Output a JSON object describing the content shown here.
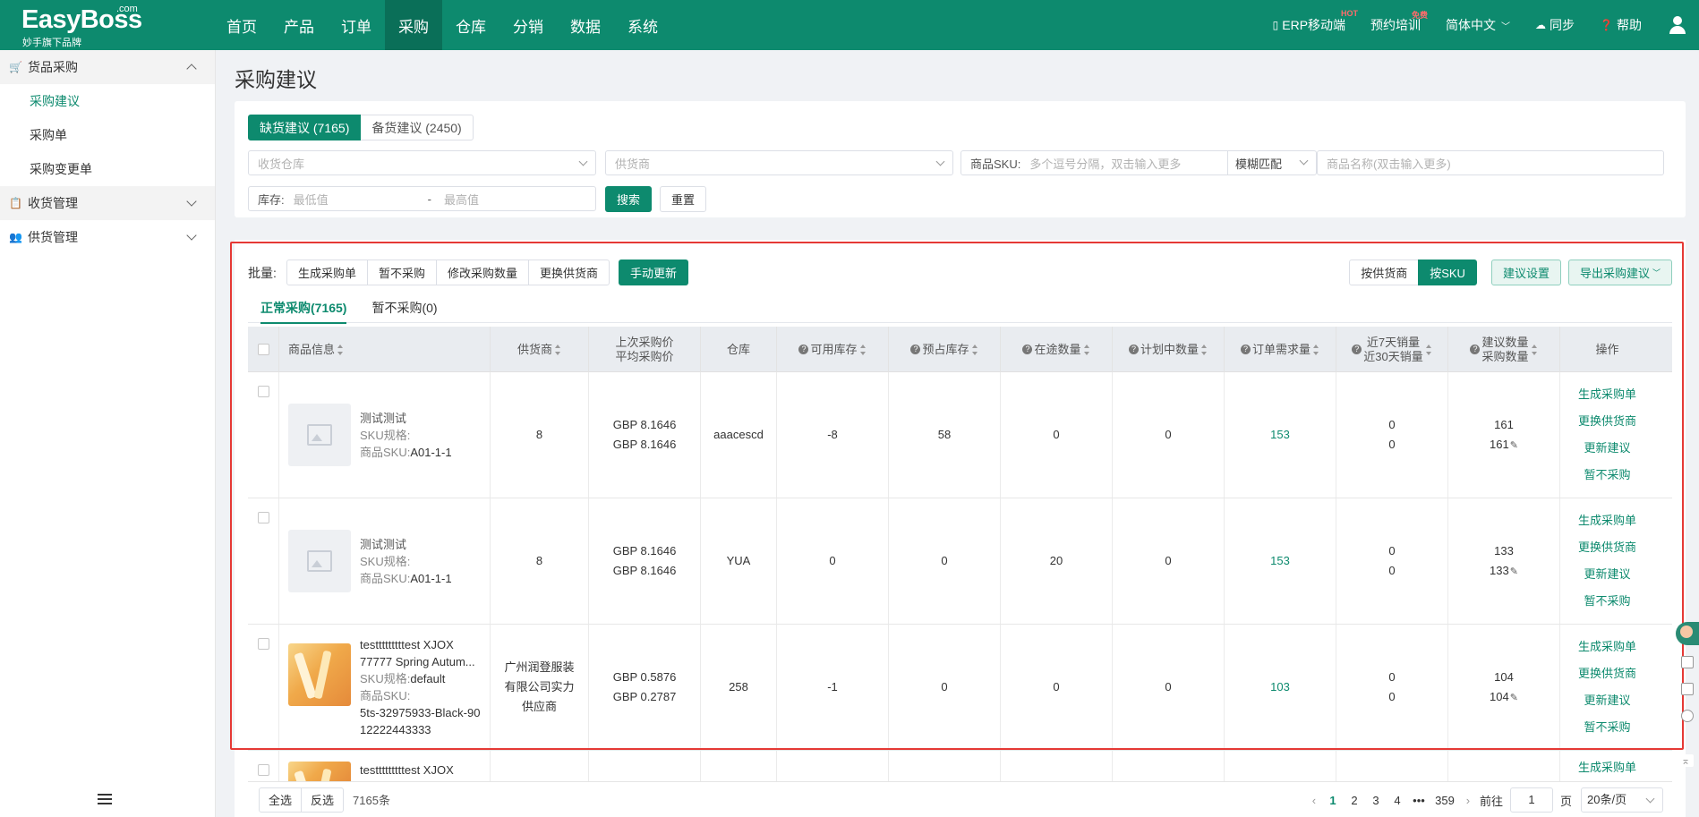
{
  "app": {
    "brand": "EasyBoss",
    "brand_com": ".com",
    "brand_sub": "妙手旗下品牌"
  },
  "topnav": {
    "menu": [
      "首页",
      "产品",
      "订单",
      "采购",
      "仓库",
      "分销",
      "数据",
      "系统"
    ],
    "active_index": 3,
    "erp": "ERP移动端",
    "erp_badge": "HOT",
    "training": "预约培训",
    "training_badge": "免费",
    "language": "简体中文",
    "sync": "同步",
    "help": "帮助"
  },
  "sidebar": {
    "groups": [
      {
        "label": "货品采购",
        "expanded": true,
        "items": [
          "采购建议",
          "采购单",
          "采购变更单"
        ],
        "active_item": 0
      },
      {
        "label": "收货管理",
        "expanded": false
      },
      {
        "label": "供货管理",
        "expanded": false
      }
    ]
  },
  "page": {
    "title": "采购建议"
  },
  "filters": {
    "tab_shortage": "缺货建议 (7165)",
    "tab_stock": "备货建议 (2450)",
    "warehouse_placeholder": "收货仓库",
    "supplier_placeholder": "供货商",
    "sku_label": "商品SKU:",
    "sku_placeholder": "多个逗号分隔，双击输入更多",
    "match_mode": "模糊匹配",
    "name_placeholder": "商品名称(双击输入更多)",
    "stock_label": "库存:",
    "min_placeholder": "最低值",
    "range_sep": "-",
    "max_placeholder": "最高值",
    "search": "搜索",
    "reset": "重置"
  },
  "toolbar": {
    "batch_label": "批量:",
    "batch_buttons": [
      "生成采购单",
      "暂不采购",
      "修改采购数量",
      "更换供货商"
    ],
    "manual_update": "手动更新",
    "by_supplier": "按供货商",
    "by_sku": "按SKU",
    "settings": "建议设置",
    "export": "导出采购建议"
  },
  "subtabs": {
    "normal": "正常采购(7165)",
    "paused": "暂不采购(0)"
  },
  "table": {
    "headers": {
      "product": "商品信息",
      "supplier": "供货商",
      "price_last": "上次采购价",
      "price_avg": "平均采购价",
      "warehouse": "仓库",
      "available": "可用库存",
      "reserved": "预占库存",
      "transit": "在途数量",
      "planned": "计划中数量",
      "demand": "订单需求量",
      "sales7": "近7天销量",
      "sales30": "近30天销量",
      "suggest": "建议数量",
      "purchase": "采购数量",
      "ops": "操作"
    },
    "sku_spec_label": "SKU规格:",
    "sku_code_label": "商品SKU:",
    "ops": [
      "生成采购单",
      "更换供货商",
      "更新建议",
      "暂不采购"
    ],
    "rows": [
      {
        "name": "测试测试",
        "spec": "",
        "sku": "A01-1-1",
        "supplier": "8",
        "price_last": "GBP 8.1646",
        "price_avg": "GBP 8.1646",
        "warehouse": "aaacescd",
        "available": "-8",
        "reserved": "58",
        "transit": "0",
        "planned": "0",
        "demand": "153",
        "sales7": "0",
        "sales30": "0",
        "suggest": "161",
        "purchase": "161"
      },
      {
        "name": "测试测试",
        "spec": "",
        "sku": "A01-1-1",
        "supplier": "8",
        "price_last": "GBP 8.1646",
        "price_avg": "GBP 8.1646",
        "warehouse": "YUA",
        "available": "0",
        "reserved": "0",
        "transit": "20",
        "planned": "0",
        "demand": "153",
        "sales7": "0",
        "sales30": "0",
        "suggest": "133",
        "purchase": "133"
      },
      {
        "name1": "testttttttttest XJOX",
        "name2": "77777 Spring Autum...",
        "spec": "default",
        "sku1": "5ts-32975933-Black-90",
        "sku2": "12222443333",
        "supplier1": "广州润登服装",
        "supplier2": "有限公司实力",
        "supplier3": "供应商",
        "price_last": "GBP 0.5876",
        "price_avg": "GBP 0.2787",
        "warehouse": "258",
        "available": "-1",
        "reserved": "0",
        "transit": "0",
        "planned": "0",
        "demand": "103",
        "sales7": "0",
        "sales30": "0",
        "suggest": "104",
        "purchase": "104"
      },
      {
        "name1": "testttttttttest XJOX",
        "op": "生成采购单"
      }
    ]
  },
  "footer": {
    "select_all": "全选",
    "invert": "反选",
    "total": "7165条",
    "pages": [
      "1",
      "2",
      "3",
      "4",
      "•••",
      "359"
    ],
    "current_page": "1",
    "goto_label": "前往",
    "goto_value": "1",
    "page_unit": "页",
    "page_size": "20条/页"
  },
  "colors": {
    "brand": "#0d8a6e",
    "highlight": "#e53935"
  }
}
